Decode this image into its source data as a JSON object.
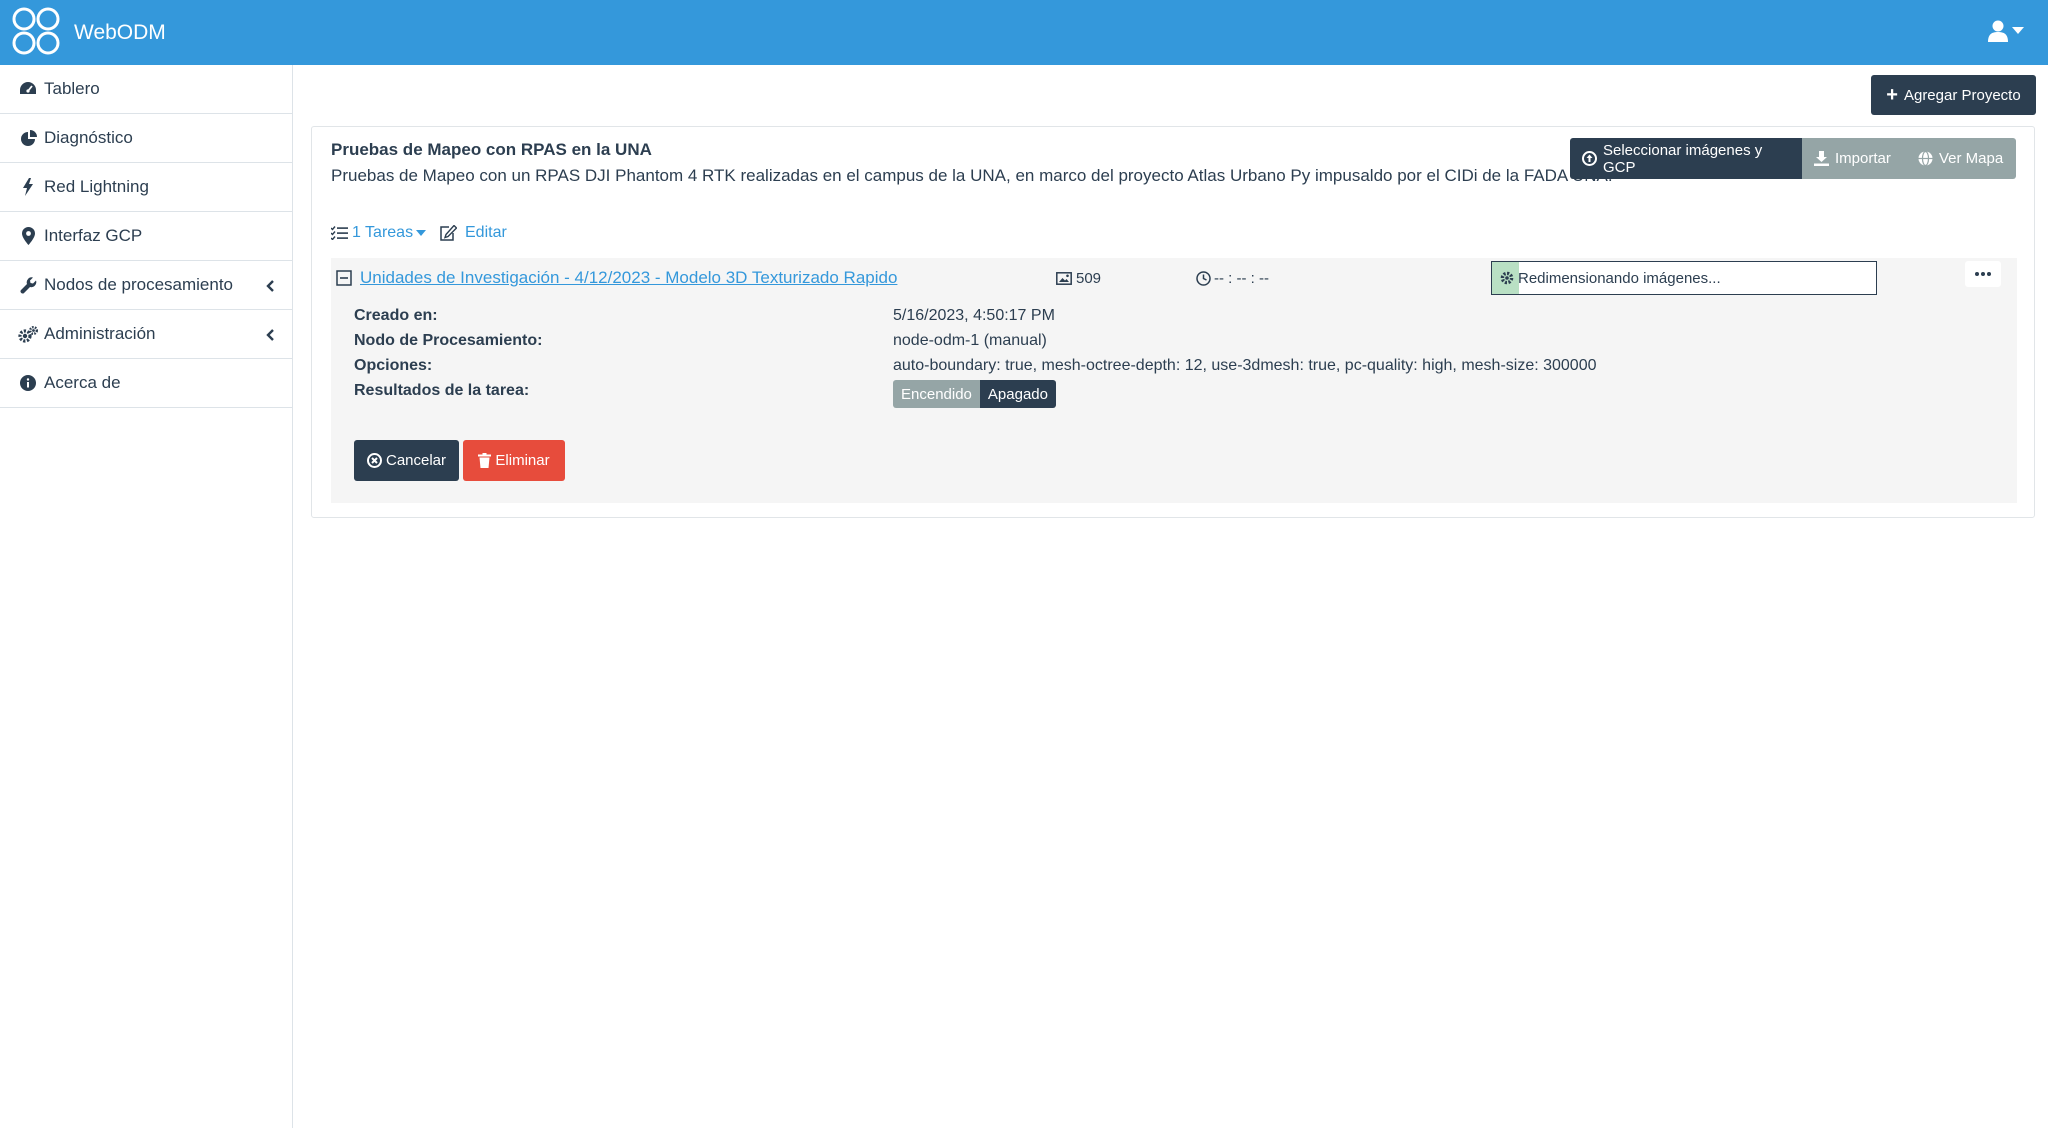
{
  "colors": {
    "navbar": "#3498db",
    "primary": "#2c3e50",
    "secondary": "#95a5a6",
    "danger": "#e74c3c",
    "link": "#3498db"
  },
  "navbar": {
    "brand": "WebODM",
    "logo_icon": "webodm-logo-icon",
    "user_icon": "user-icon"
  },
  "sidebar": {
    "items": [
      {
        "label": "Tablero",
        "icon": "dashboard-icon"
      },
      {
        "label": "Diagnóstico",
        "icon": "pie-chart-icon"
      },
      {
        "label": "Red Lightning",
        "icon": "bolt-icon"
      },
      {
        "label": "Interfaz GCP",
        "icon": "map-marker-icon"
      },
      {
        "label": "Nodos de procesamiento",
        "icon": "wrench-icon",
        "expandable": true
      },
      {
        "label": "Administración",
        "icon": "gears-icon",
        "expandable": true
      },
      {
        "label": "Acerca de",
        "icon": "info-icon"
      }
    ]
  },
  "main": {
    "add_project_label": "Agregar Proyecto",
    "project": {
      "title": "Pruebas de Mapeo con RPAS en la UNA",
      "description": "Pruebas de Mapeo con un RPAS DJI Phantom 4 RTK realizadas en el campus de la UNA, en marco del proyecto Atlas Urbano Py impusaldo por el CIDi de la FADA UNA.",
      "buttons": {
        "select_images": "Seleccionar imágenes y GCP",
        "import": "Importar",
        "view_map": "Ver Mapa"
      },
      "tasks_link": "1 Tareas",
      "edit_link": "Editar",
      "task": {
        "name": "Unidades de Investigación - 4/12/2023 - Modelo 3D Texturizado Rapido",
        "image_count": "509",
        "duration": "-- : -- : --",
        "status": "Redimensionando imágenes...",
        "progress_fraction": 0.07,
        "details": {
          "created_label": "Creado en:",
          "created_value": "5/16/2023, 4:50:17 PM",
          "node_label": "Nodo de Procesamiento:",
          "node_value": "node-odm-1 (manual)",
          "options_label": "Opciones:",
          "options_value": "auto-boundary: true, mesh-octree-depth: 12, use-3dmesh: true, pc-quality: high, mesh-size: 300000",
          "results_label": "Resultados de la tarea:",
          "results_on": "Encendido",
          "results_off": "Apagado"
        },
        "cancel_label": "Cancelar",
        "delete_label": "Eliminar"
      }
    }
  }
}
